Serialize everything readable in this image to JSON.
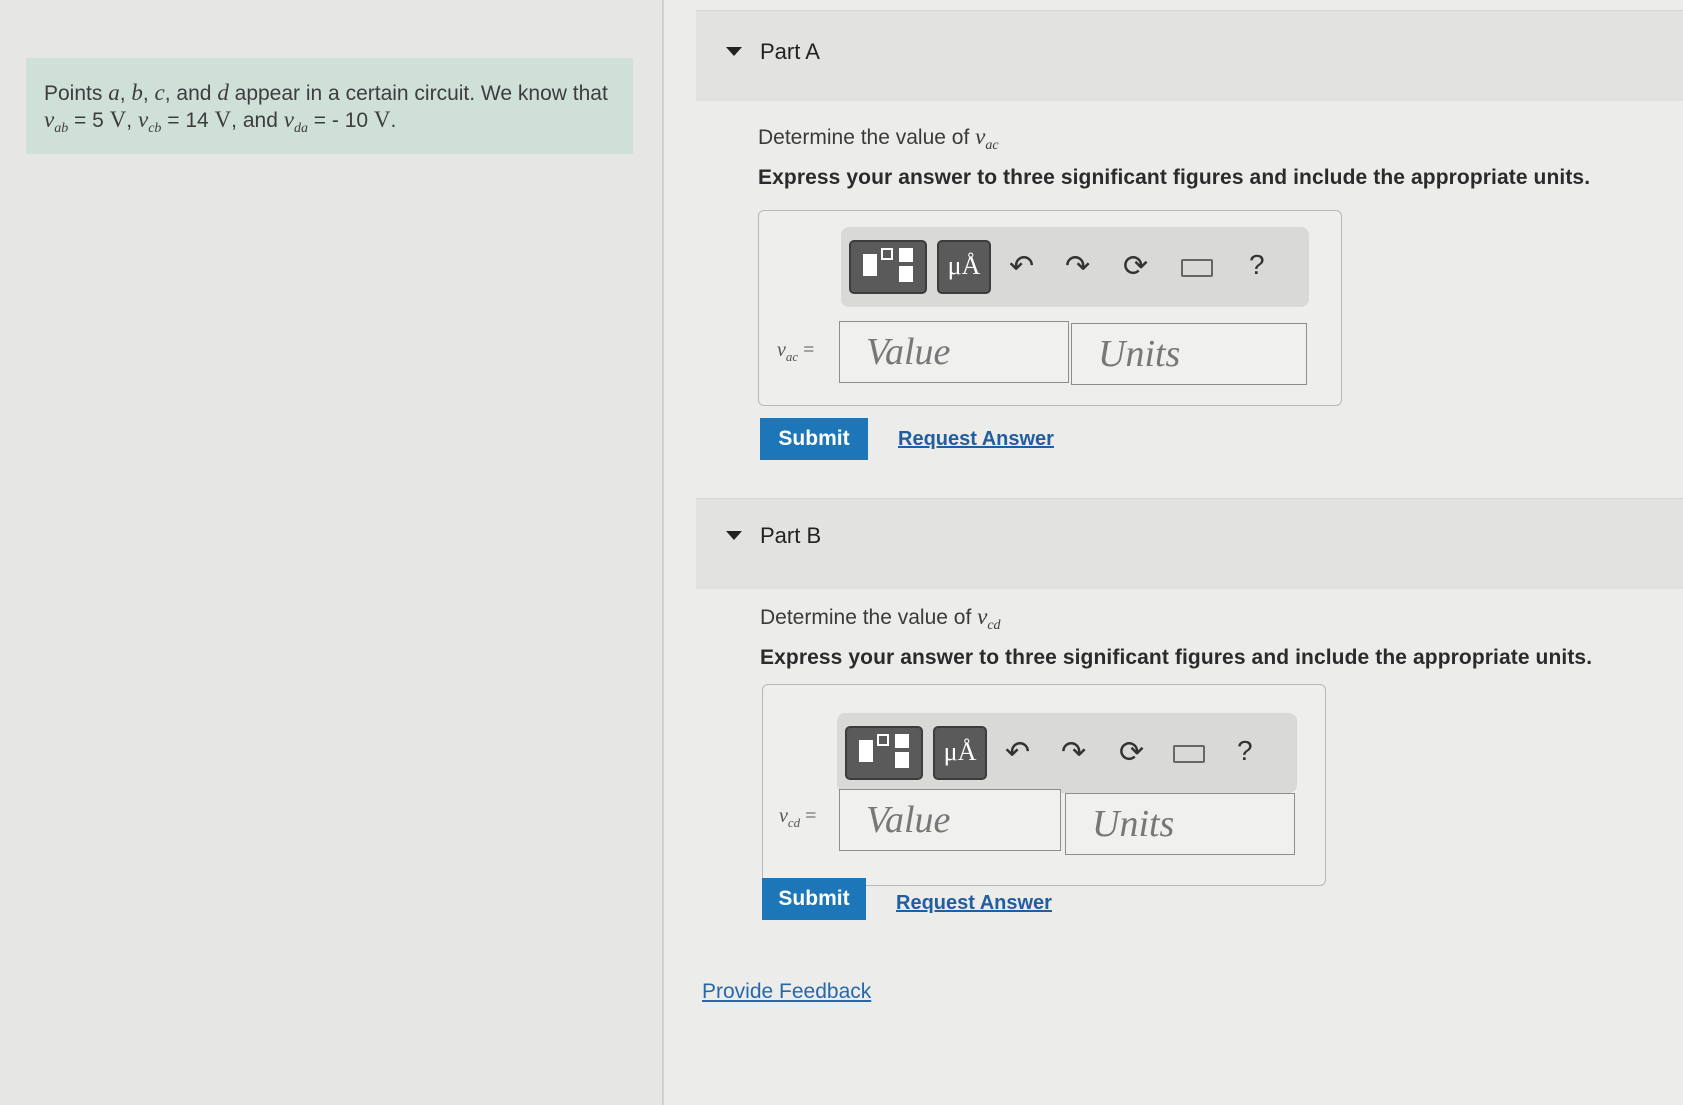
{
  "problem": {
    "intro": "Points ",
    "a": "a",
    "b": "b",
    "c": "c",
    "d": "d",
    "sep1": ", ",
    "sep2": ", ",
    "and_word": ", and ",
    "tail": " appear in a certain circuit. We know that",
    "v_ab": "v",
    "sub_ab": "ab",
    "eq_ab": " = 5 ",
    "unit_V1": "V",
    "comma1": ", ",
    "v_cb": "v",
    "sub_cb": "cb",
    "eq_cb": " = 14 ",
    "unit_V2": "V",
    "and2": ", and ",
    "v_da": "v",
    "sub_da": "da",
    "eq_da": " = - 10 ",
    "unit_V3": "V",
    "period": "."
  },
  "partA": {
    "title": "Part A",
    "determine_prefix": "Determine the value of ",
    "var": "v",
    "var_sub": "ac",
    "express": "Express your answer to three significant figures and include the appropriate units.",
    "toolbar": {
      "template_icon": "template-icon",
      "units_glyph": "μÅ",
      "undo": "↶",
      "redo": "↷",
      "reset": "⟳",
      "keyboard_icon": "keyboard-icon",
      "help": "?"
    },
    "label_var": "v",
    "label_sub": "ac",
    "label_eq": " =",
    "value_placeholder": "Value",
    "units_placeholder": "Units",
    "submit": "Submit",
    "request": "Request Answer"
  },
  "partB": {
    "title": "Part B",
    "determine_prefix": "Determine the value of ",
    "var": "v",
    "var_sub": "cd",
    "express": "Express your answer to three significant figures and include the appropriate units.",
    "toolbar": {
      "template_icon": "template-icon",
      "units_glyph": "μÅ",
      "undo": "↶",
      "redo": "↷",
      "reset": "⟳",
      "keyboard_icon": "keyboard-icon",
      "help": "?"
    },
    "label_var": "v",
    "label_sub": "cd",
    "label_eq": " =",
    "value_placeholder": "Value",
    "units_placeholder": "Units",
    "submit": "Submit",
    "request": "Request Answer"
  },
  "feedback": "Provide Feedback",
  "colors": {
    "accent": "#1c76b8",
    "problem_bg": "#cfe0d9",
    "link": "#1f5fa0"
  }
}
